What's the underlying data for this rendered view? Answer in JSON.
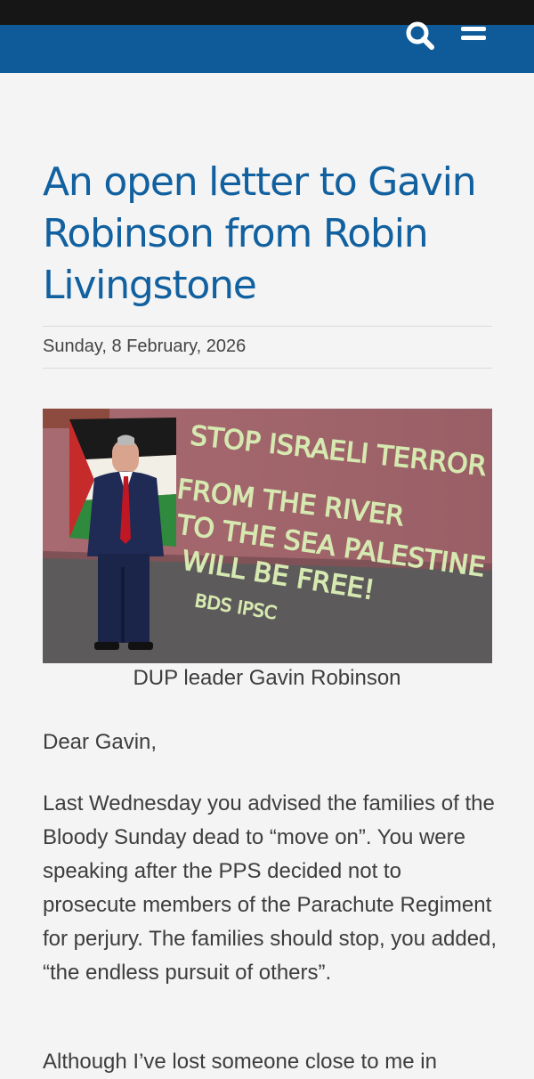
{
  "header": {
    "search_icon": "search-icon",
    "menu_icon": "hamburger-menu-icon",
    "color": "#0f5b99"
  },
  "article": {
    "title": "An open letter to Gavin Robinson from Robin Livingstone",
    "date": "Sunday, 8 February, 2026",
    "image_caption": "DUP leader Gavin Robinson",
    "image_wall_text": [
      "STOP ISRAELI TERROR",
      "FROM THE RIVER",
      "TO THE SEA PALESTINE",
      "WILL BE FREE!",
      "BDS IPSC"
    ],
    "salutation": "Dear Gavin,",
    "paragraphs": [
      "Last Wednesday you advised the families of the Bloody Sunday dead to “move on”. You were speaking after the PPS decided not to prosecute members of the Parachute Regiment for perjury. The families should stop, you added, “the endless pursuit of others”.",
      "Although I’ve lost someone close to me in"
    ]
  }
}
